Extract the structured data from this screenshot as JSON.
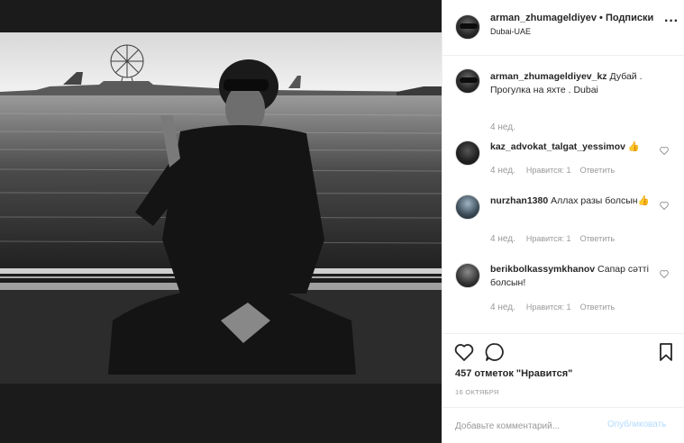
{
  "post": {
    "header": {
      "username": "arman_zhumageldiyev",
      "separator": " • ",
      "follow_label": "Подписки",
      "location": "Dubai-UAE",
      "more_icon": "ellipsis-icon"
    },
    "caption": {
      "username": "arman_zhumageldiyev_kz",
      "text": " Дубай . Прогулка на яхте . Dubai",
      "time": "4 нед."
    },
    "comments": [
      {
        "username": "kaz_advokat_talgat_yessimov",
        "text": " 👍",
        "time": "4 нед.",
        "likes": "Нравится: 1",
        "reply": "Ответить"
      },
      {
        "username": "nurzhan1380",
        "text": " Аллах разы болсын👍",
        "time": "4 нед.",
        "likes": "Нравится: 1",
        "reply": "Ответить"
      },
      {
        "username": "berikbolkassymkhanov",
        "text": " Сапар сәтті болсын!",
        "time": "4 нед.",
        "likes": "Нравится: 1",
        "reply": "Ответить"
      }
    ],
    "likes_text": "457 отметок \"Нравится\"",
    "date": "16 ОКТЯБРЯ",
    "add_comment": {
      "placeholder": "Добавьте комментарий...",
      "publish_label": "Опубликовать"
    },
    "colors": {
      "text": "#262626",
      "muted": "#999999",
      "publish_disabled": "#b3dbff",
      "border": "#efefef"
    }
  }
}
